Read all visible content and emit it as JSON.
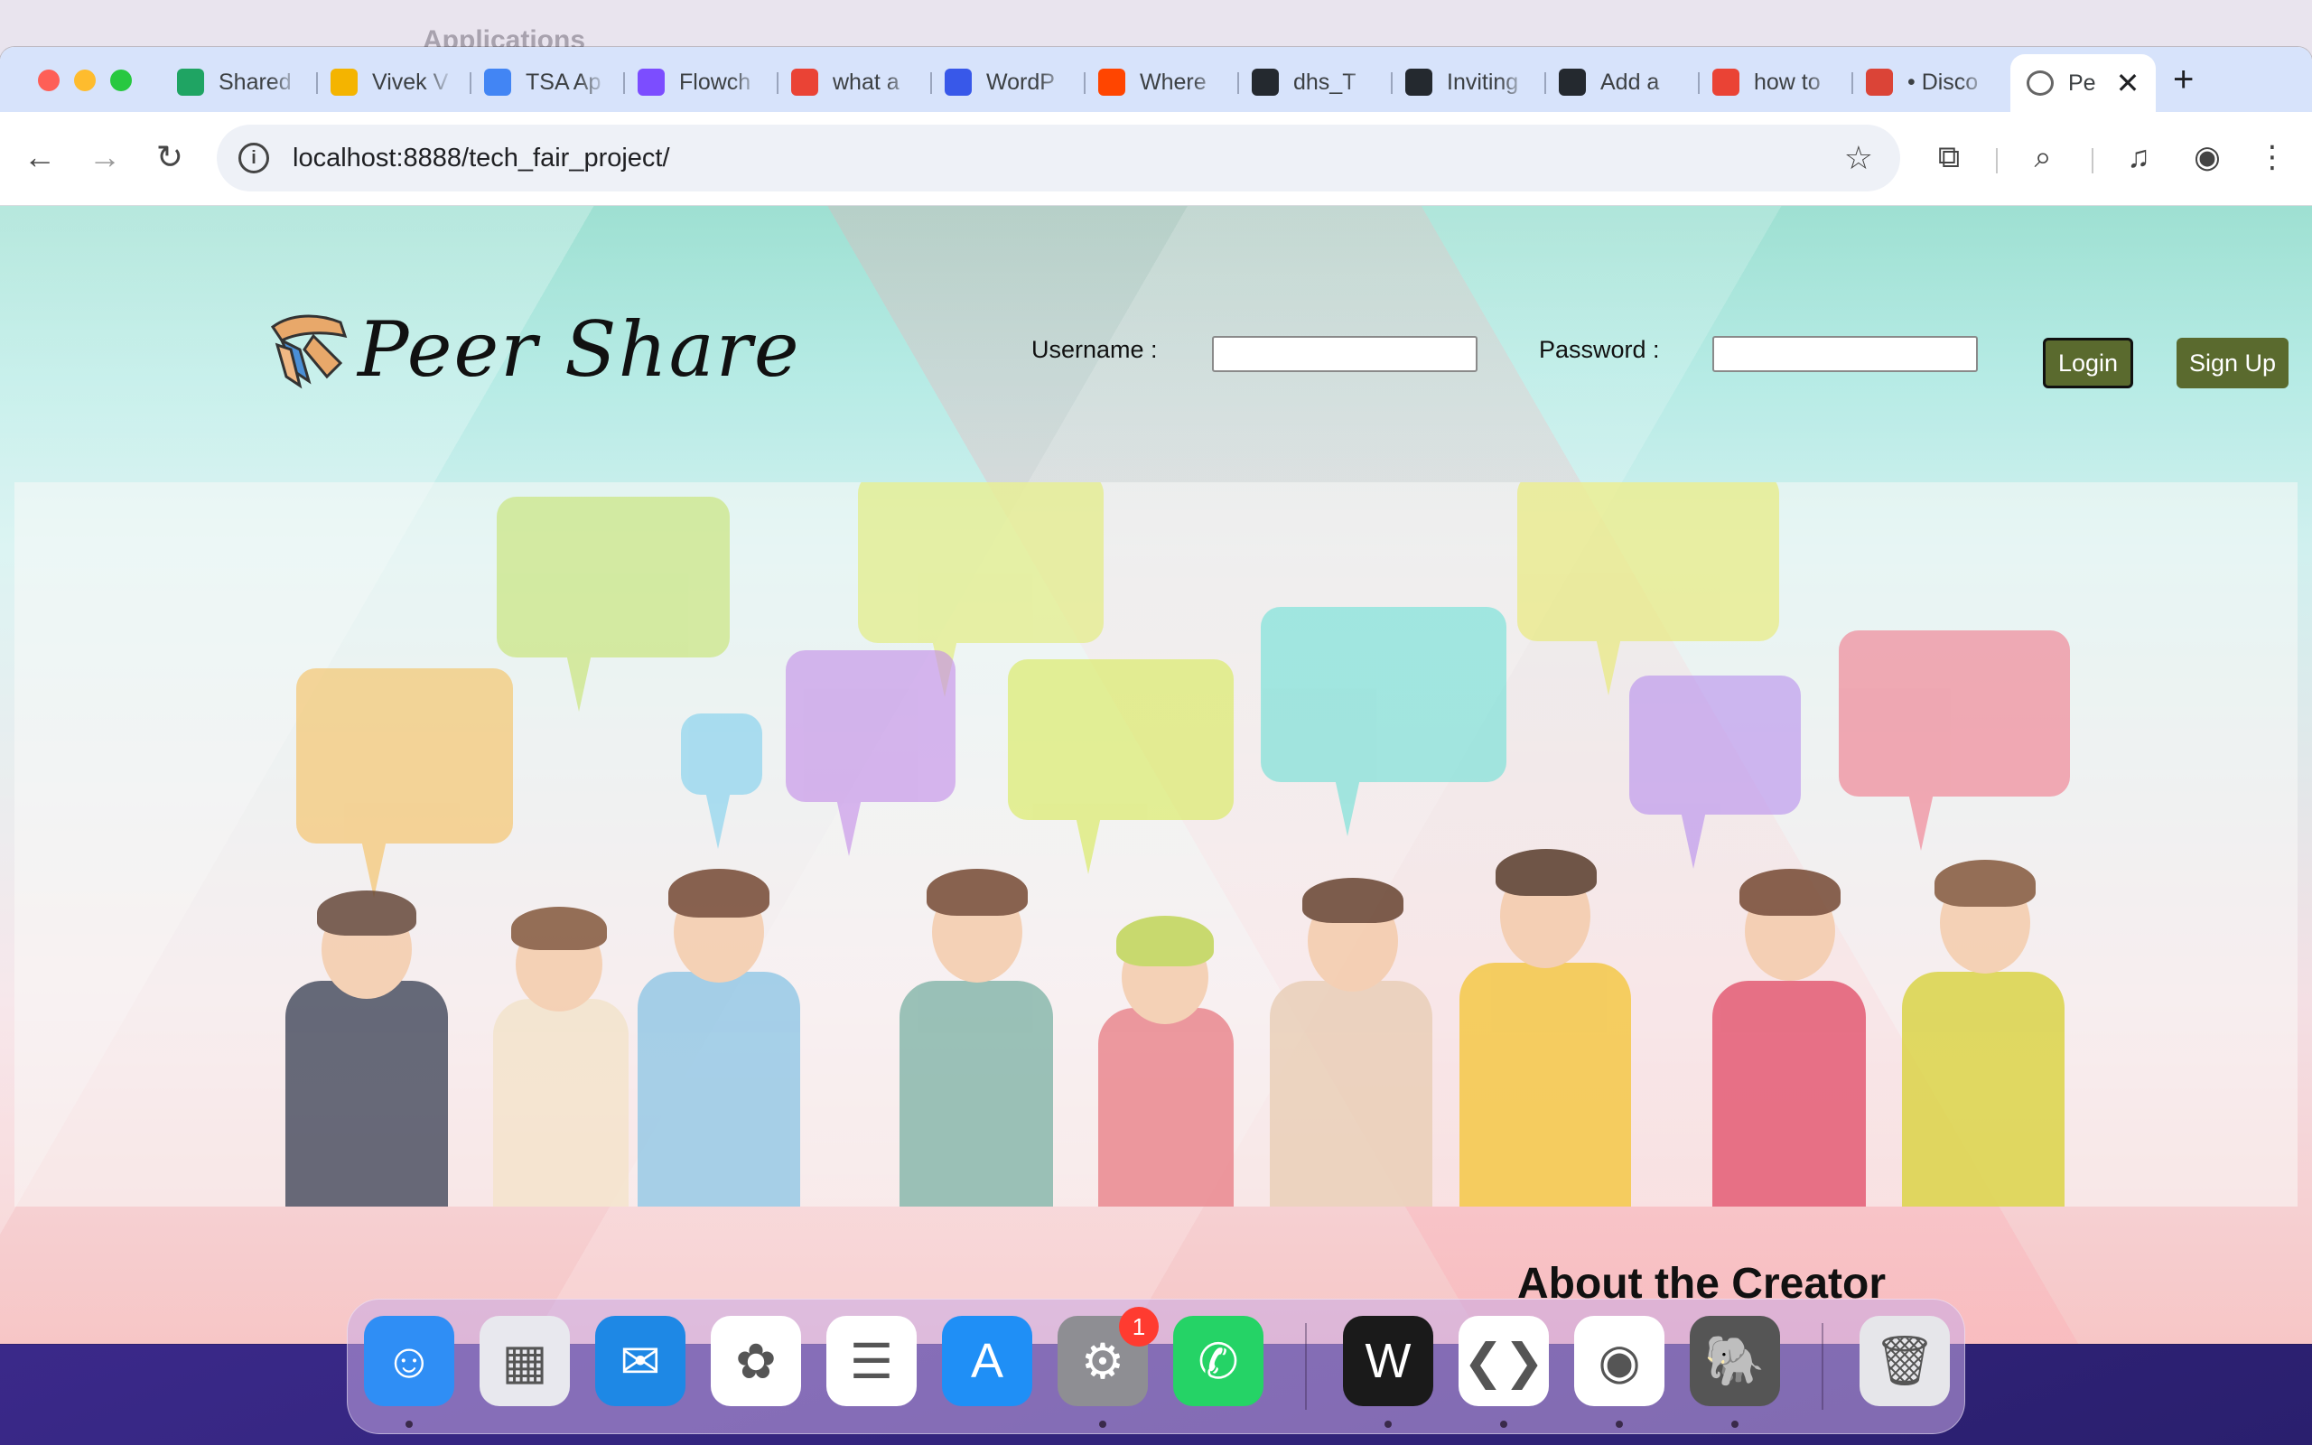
{
  "background_window": {
    "title": "Applications"
  },
  "browser": {
    "tabs": [
      {
        "title": "Shared",
        "icon": "google-drive-icon",
        "color": "#1fa463"
      },
      {
        "title": "Vivek V",
        "icon": "google-slides-icon",
        "color": "#f4b400"
      },
      {
        "title": "TSA Ap",
        "icon": "google-docs-icon",
        "color": "#4285f4"
      },
      {
        "title": "Flowch",
        "icon": "flowchart-icon",
        "color": "#7c4dff"
      },
      {
        "title": "what a",
        "icon": "google-icon",
        "color": "#ea4335"
      },
      {
        "title": "WordP",
        "icon": "wordpress-icon",
        "color": "#3858e9"
      },
      {
        "title": "Where",
        "icon": "reddit-icon",
        "color": "#ff4500"
      },
      {
        "title": "dhs_T",
        "icon": "github-icon",
        "color": "#24292f"
      },
      {
        "title": "Inviting",
        "icon": "github-icon",
        "color": "#24292f"
      },
      {
        "title": "Add a",
        "icon": "github-icon",
        "color": "#24292f"
      },
      {
        "title": "how to",
        "icon": "google-icon",
        "color": "#ea4335"
      },
      {
        "title": "• Disco",
        "icon": "chrome-icon",
        "color": "#db4437"
      }
    ],
    "active_tab": {
      "title": "Pe",
      "icon": "peer-share-icon",
      "color": "#666666"
    },
    "url": "localhost:8888/tech_fair_project/"
  },
  "site": {
    "logo_text": "Peer Share",
    "username_label": "Username :",
    "password_label": "Password :",
    "username_value": "",
    "password_value": "",
    "login_label": "Login",
    "signup_label": "Sign Up",
    "about_heading": "About the Creator"
  },
  "dock": {
    "apps": [
      {
        "name": "Finder",
        "icon": "finder-icon",
        "color": "#2f8ef5",
        "running": true
      },
      {
        "name": "Launchpad",
        "icon": "launchpad-icon",
        "color": "#e8e8ee",
        "running": false
      },
      {
        "name": "Mail",
        "icon": "mail-icon",
        "color": "#1e88e5",
        "running": false
      },
      {
        "name": "Photos",
        "icon": "photos-icon",
        "color": "#ffffff",
        "running": false
      },
      {
        "name": "Reminders",
        "icon": "reminders-icon",
        "color": "#ffffff",
        "running": false
      },
      {
        "name": "App Store",
        "icon": "app-store-icon",
        "color": "#1f8ff6",
        "running": false
      },
      {
        "name": "System Settings",
        "icon": "settings-icon",
        "color": "#8e8e93",
        "running": true,
        "badge": "1"
      },
      {
        "name": "WhatsApp",
        "icon": "whatsapp-icon",
        "color": "#25d366",
        "running": false
      },
      {
        "name": "Webex",
        "icon": "webex-icon",
        "color": "#1a1a1a",
        "running": true
      },
      {
        "name": "VS Code",
        "icon": "vscode-icon",
        "color": "#ffffff",
        "running": true
      },
      {
        "name": "Chrome",
        "icon": "chrome-icon",
        "color": "#ffffff",
        "running": true
      },
      {
        "name": "MAMP",
        "icon": "mamp-icon",
        "color": "#555555",
        "running": true
      },
      {
        "name": "Trash",
        "icon": "trash-icon",
        "color": "#e6e6ea",
        "running": false
      }
    ]
  }
}
